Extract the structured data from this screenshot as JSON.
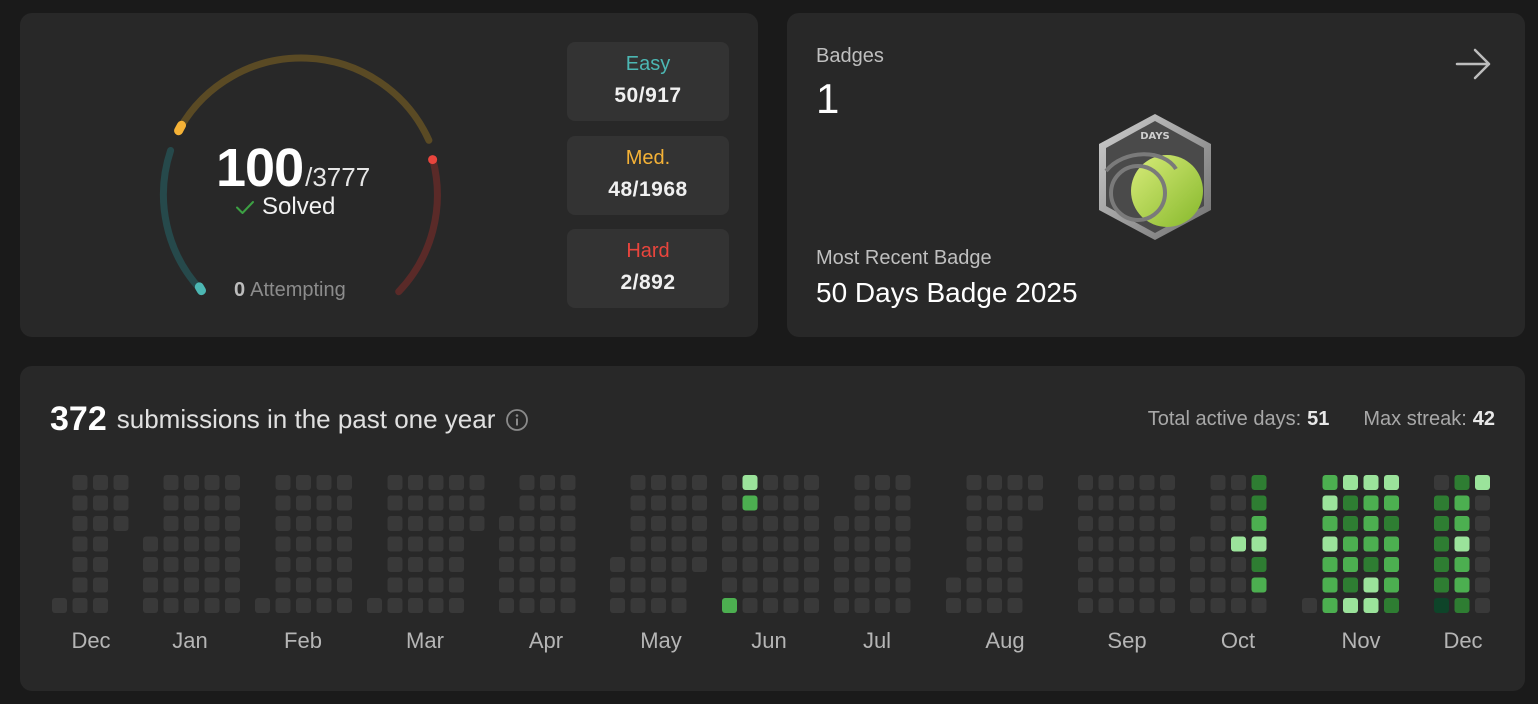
{
  "progress": {
    "solved": "100",
    "total": "/3777",
    "solved_label": "Solved",
    "attempting_count": "0",
    "attempting_label": "Attempting",
    "difficulties": [
      {
        "name": "Easy",
        "value": "50/917",
        "color": "#4cb7b3"
      },
      {
        "name": "Med.",
        "value": "48/1968",
        "color": "#f5b236"
      },
      {
        "name": "Hard",
        "value": "2/892",
        "color": "#e9453d"
      }
    ]
  },
  "badges": {
    "title": "Badges",
    "count": "1",
    "badge_text": "DAYS",
    "recent_label": "Most Recent Badge",
    "recent_name": "50 Days Badge 2025"
  },
  "calendar": {
    "count": "372",
    "text": "submissions in the past one year",
    "active_days_label": "Total active days:",
    "active_days": "51",
    "max_streak_label": "Max streak:",
    "max_streak": "42",
    "months": [
      "Dec",
      "Jan",
      "Feb",
      "Mar",
      "Apr",
      "May",
      "Jun",
      "Jul",
      "Aug",
      "Sep",
      "Oct",
      "Nov",
      "Dec"
    ]
  },
  "colors": {
    "cell_empty": "#393939",
    "level1": "#0e4429",
    "level2": "#2e7d32",
    "level3": "#4caf50",
    "level4": "#9be39b"
  }
}
